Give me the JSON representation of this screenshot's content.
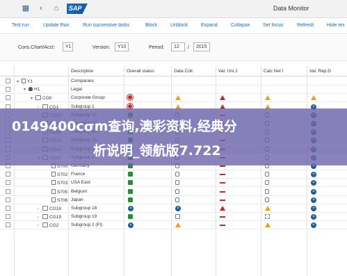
{
  "app": {
    "title": "Data Monitor",
    "logo_text": "SAP"
  },
  "shell": {
    "icons": [
      "grid-icon",
      "back-icon",
      "home-icon"
    ]
  },
  "toolbar": {
    "buttons": [
      "Test run",
      "Update Run",
      "Run successive tasks",
      "Block",
      "Unblock",
      "Expand",
      "Collapse",
      "Set focus",
      "Refresh",
      "Hide tex"
    ]
  },
  "filters": {
    "cons_chart_label": "Cons.Chart/Acct:",
    "cons_chart_value": "Y1",
    "version_label": "Version:",
    "version_value": "Y10",
    "period_label": "Period:",
    "period_value": "12",
    "period_sep": "/",
    "year_value": "2015"
  },
  "grid": {
    "columns": [
      "",
      "Description",
      "Overall status",
      "Data Coll.",
      "Val. Uni.J",
      "Calc Net I",
      "Val. Rep.D"
    ],
    "rows": [
      {
        "node": "Y1",
        "desc": "Companies",
        "level": 1,
        "exp": "▾",
        "icon": "doc",
        "status": []
      },
      {
        "node": "H1",
        "desc": "Legal",
        "level": 2,
        "exp": "▾",
        "icon": "person",
        "status": []
      },
      {
        "node": "CG0",
        "desc": "Corporate Group",
        "level": 3,
        "exp": "▾",
        "icon": "folder",
        "status": [
          "burst",
          "warning",
          "error-tri",
          "warning",
          "warning"
        ]
      },
      {
        "node": "CG1",
        "desc": "Subgroup 1",
        "level": 4,
        "exp": "›",
        "icon": "folder",
        "status": [
          "burst",
          "warning",
          "error-tri",
          "warning",
          "blocked"
        ]
      },
      {
        "node": "CG12",
        "desc": "Subgroup 12",
        "level": 4,
        "exp": "›",
        "icon": "folder",
        "status": [
          "square",
          "lock",
          "dash",
          "lock",
          "blocked"
        ]
      },
      {
        "node": "CG13",
        "desc": "Subgroup 13",
        "level": 4,
        "exp": "›",
        "icon": "folder",
        "status": [
          "square",
          "lock",
          "dash",
          "lock",
          "blocked"
        ]
      },
      {
        "node": "CG14",
        "desc": "Subgroup 14",
        "level": 4,
        "exp": "›",
        "icon": "folder",
        "status": [
          "square",
          "lock",
          "dash",
          "lock",
          "blocked"
        ]
      },
      {
        "node": "CG15",
        "desc": "Subgroup 15",
        "level": 4,
        "exp": "›",
        "icon": "folder",
        "status": [
          "square",
          "lock",
          "dash",
          "lock",
          "blocked"
        ]
      },
      {
        "node": "CG16",
        "desc": "Subgroup 16",
        "level": 4,
        "exp": "›",
        "icon": "folder",
        "status": [
          "square",
          "lock",
          "dash",
          "lock",
          "blocked"
        ]
      },
      {
        "node": "CG17",
        "desc": "Subgroup 17",
        "level": 4,
        "exp": "▾",
        "icon": "folder",
        "status": [
          "square",
          "lock",
          "dash",
          "lock",
          "blocked"
        ]
      },
      {
        "node": "S700",
        "desc": "Germany",
        "level": 5,
        "exp": "",
        "icon": "doc",
        "status": [
          "square",
          "lock",
          "dash",
          "lock",
          "blocked"
        ]
      },
      {
        "node": "S702",
        "desc": "France",
        "level": 5,
        "exp": "",
        "icon": "doc",
        "status": [
          "square",
          "lock",
          "dash",
          "lock",
          "blocked"
        ]
      },
      {
        "node": "S703",
        "desc": "USA East",
        "level": 5,
        "exp": "",
        "icon": "doc",
        "status": [
          "square",
          "lock",
          "dash",
          "lock",
          "blocked"
        ]
      },
      {
        "node": "S705",
        "desc": "Belgium",
        "level": 5,
        "exp": "",
        "icon": "doc",
        "status": [
          "square",
          "lock",
          "dash",
          "lock",
          "blocked"
        ]
      },
      {
        "node": "S706",
        "desc": "Japan",
        "level": 5,
        "exp": "",
        "icon": "doc",
        "status": [
          "square",
          "lock",
          "dash",
          "lock",
          "blocked"
        ]
      },
      {
        "node": "CG18",
        "desc": "Subgroup 18",
        "level": 4,
        "exp": "›",
        "icon": "folder",
        "status": [
          "blocked",
          "blocked",
          "error-tri",
          "warning",
          "blocked"
        ]
      },
      {
        "node": "CG19",
        "desc": "Subgroup 19",
        "level": 4,
        "exp": "›",
        "icon": "folder",
        "status": [
          "square",
          "doc",
          "dash",
          "dashbox",
          "blocked"
        ]
      },
      {
        "node": "CG2",
        "desc": "Subgroup 2 (FI)",
        "level": 4,
        "exp": "›",
        "icon": "folder",
        "status": [
          "blocked",
          "warning",
          "dash",
          "warning",
          "blocked"
        ]
      }
    ]
  },
  "overlay": {
    "line1": "0149400cσm查询,澳彩资料,经典分",
    "line2": "析说明_领航版7.722"
  }
}
